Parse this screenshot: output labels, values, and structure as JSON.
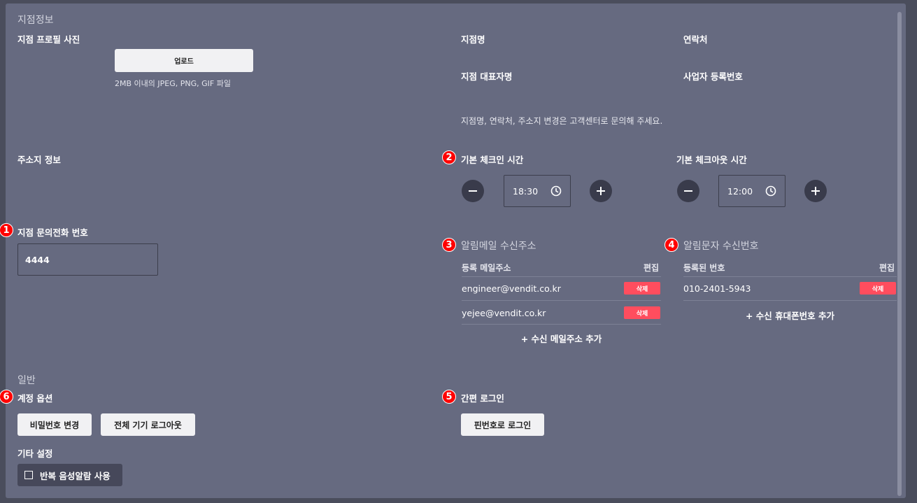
{
  "branch_info": {
    "section_title": "지점정보",
    "profile_photo_label": "지점 프로필 사진",
    "upload_button": "업로드",
    "upload_hint": "2MB 이내의 JPEG, PNG, GIF 파일",
    "branch_name_label": "지점명",
    "contact_label": "연락처",
    "representative_label": "지점 대표자명",
    "business_number_label": "사업자 등록번호",
    "change_notice": "지점명, 연락처, 주소지 변경은 고객센터로 문의해 주세요.",
    "address_label": "주소지 정보"
  },
  "phone": {
    "badge": "1",
    "label": "지점 문의전화 번호",
    "value": "4444"
  },
  "checkin": {
    "badge": "2",
    "label": "기본 체크인 시간",
    "value": "18:30"
  },
  "checkout": {
    "label": "기본 체크아웃 시간",
    "value": "12:00"
  },
  "email": {
    "badge": "3",
    "label": "알림메일 수신주소",
    "col_address": "등록 메일주소",
    "col_edit": "편집",
    "rows": [
      "engineer@vendit.co.kr",
      "yejee@vendit.co.kr"
    ],
    "delete_label": "삭제",
    "add_label": "+ 수신 메일주소 추가"
  },
  "sms": {
    "badge": "4",
    "label": "알림문자 수신번호",
    "col_number": "등록된 번호",
    "col_edit": "편집",
    "rows": [
      "010-2401-5943"
    ],
    "delete_label": "삭제",
    "add_label": "+ 수신 휴대폰번호 추가"
  },
  "general": {
    "section_title": "일반",
    "account_badge": "6",
    "account_label": "계정 옵션",
    "change_password": "비밀번호 변경",
    "logout_all": "전체 기기 로그아웃",
    "other_settings_label": "기타 설정",
    "repeat_voice_alarm": "반복 음성알람 사용",
    "quick_login_badge": "5",
    "quick_login_label": "간편 로그인",
    "pin_login": "핀번호로 로그인"
  },
  "colors": {
    "background": "#4a4d5c",
    "panel": "#666a80",
    "danger": "#ff4d5e",
    "badge": "#ff0000",
    "control_dark": "#393b4b"
  },
  "icons": {
    "clock": "clock-icon",
    "minus": "minus-icon",
    "plus": "plus-icon",
    "checkbox": "checkbox-icon"
  }
}
